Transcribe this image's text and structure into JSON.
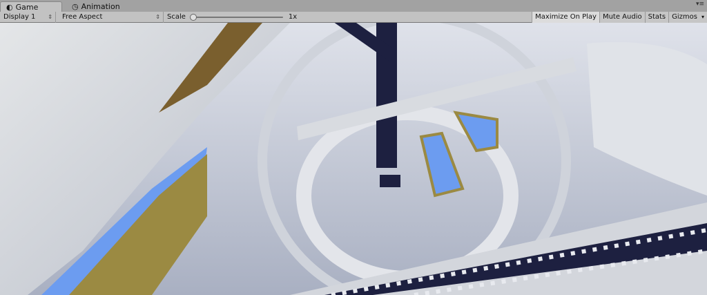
{
  "tabs": [
    {
      "label": "Game",
      "icon": "game-controller-icon"
    },
    {
      "label": "Animation",
      "icon": "clock-icon"
    }
  ],
  "toolbar": {
    "display": "Display 1",
    "aspect": "Free Aspect",
    "scale_label": "Scale",
    "scale_value": "1x",
    "scale_fraction": 0,
    "maximize": "Maximize On Play",
    "mute": "Mute Audio",
    "stats": "Stats",
    "gizmos": "Gizmos",
    "maximize_active": true
  },
  "colors": {
    "toolbar": "#c2c2c2",
    "sky": "#6c9cf0",
    "stone": "#c9cdd6",
    "wood": "#8a7a3a"
  }
}
